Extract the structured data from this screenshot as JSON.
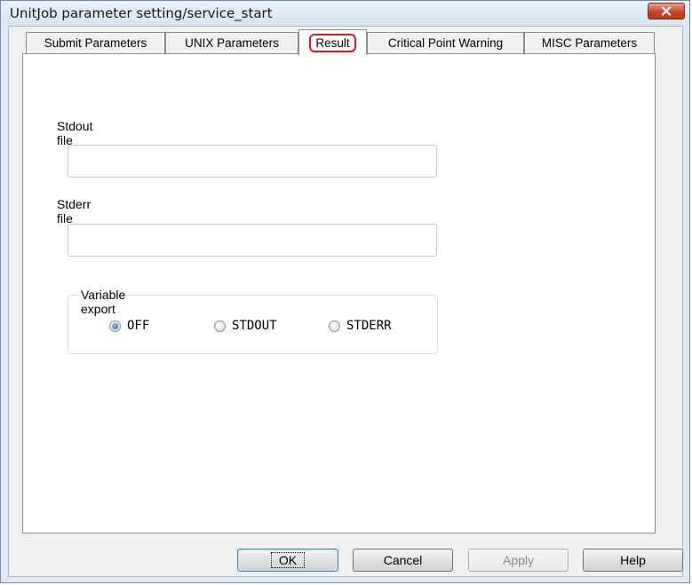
{
  "window": {
    "title": "UnitJob parameter setting/service_start"
  },
  "tabs": [
    {
      "label": "Submit Parameters",
      "active": false
    },
    {
      "label": "UNIX Parameters",
      "active": false
    },
    {
      "label": "Result",
      "active": true
    },
    {
      "label": "Critical Point Warning",
      "active": false
    },
    {
      "label": "MISC Parameters",
      "active": false
    }
  ],
  "result": {
    "stdout_label": "Stdout file",
    "stdout_value": "",
    "stderr_label": "Stderr file",
    "stderr_value": "",
    "variable_export": {
      "group_label": "Variable export",
      "options": [
        {
          "label": "OFF",
          "checked": true
        },
        {
          "label": "STDOUT",
          "checked": false
        },
        {
          "label": "STDERR",
          "checked": false
        }
      ]
    }
  },
  "buttons": {
    "ok": "OK",
    "cancel": "Cancel",
    "apply": "Apply",
    "help": "Help"
  },
  "colors": {
    "active_tab_highlight": "#e8141c",
    "close_button": "#c9452a",
    "radio_selected": "#1d5fa8"
  },
  "icons": {
    "close": "close-icon"
  }
}
